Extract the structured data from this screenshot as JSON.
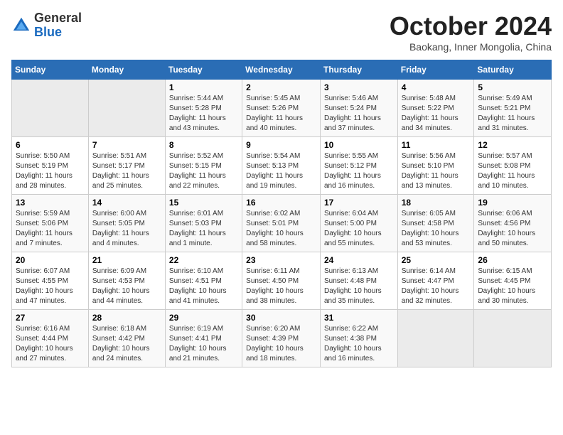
{
  "header": {
    "logo_line1": "General",
    "logo_line2": "Blue",
    "month": "October 2024",
    "location": "Baokang, Inner Mongolia, China"
  },
  "days_of_week": [
    "Sunday",
    "Monday",
    "Tuesday",
    "Wednesday",
    "Thursday",
    "Friday",
    "Saturday"
  ],
  "weeks": [
    [
      {
        "day": "",
        "detail": ""
      },
      {
        "day": "",
        "detail": ""
      },
      {
        "day": "1",
        "detail": "Sunrise: 5:44 AM\nSunset: 5:28 PM\nDaylight: 11 hours and 43 minutes."
      },
      {
        "day": "2",
        "detail": "Sunrise: 5:45 AM\nSunset: 5:26 PM\nDaylight: 11 hours and 40 minutes."
      },
      {
        "day": "3",
        "detail": "Sunrise: 5:46 AM\nSunset: 5:24 PM\nDaylight: 11 hours and 37 minutes."
      },
      {
        "day": "4",
        "detail": "Sunrise: 5:48 AM\nSunset: 5:22 PM\nDaylight: 11 hours and 34 minutes."
      },
      {
        "day": "5",
        "detail": "Sunrise: 5:49 AM\nSunset: 5:21 PM\nDaylight: 11 hours and 31 minutes."
      }
    ],
    [
      {
        "day": "6",
        "detail": "Sunrise: 5:50 AM\nSunset: 5:19 PM\nDaylight: 11 hours and 28 minutes."
      },
      {
        "day": "7",
        "detail": "Sunrise: 5:51 AM\nSunset: 5:17 PM\nDaylight: 11 hours and 25 minutes."
      },
      {
        "day": "8",
        "detail": "Sunrise: 5:52 AM\nSunset: 5:15 PM\nDaylight: 11 hours and 22 minutes."
      },
      {
        "day": "9",
        "detail": "Sunrise: 5:54 AM\nSunset: 5:13 PM\nDaylight: 11 hours and 19 minutes."
      },
      {
        "day": "10",
        "detail": "Sunrise: 5:55 AM\nSunset: 5:12 PM\nDaylight: 11 hours and 16 minutes."
      },
      {
        "day": "11",
        "detail": "Sunrise: 5:56 AM\nSunset: 5:10 PM\nDaylight: 11 hours and 13 minutes."
      },
      {
        "day": "12",
        "detail": "Sunrise: 5:57 AM\nSunset: 5:08 PM\nDaylight: 11 hours and 10 minutes."
      }
    ],
    [
      {
        "day": "13",
        "detail": "Sunrise: 5:59 AM\nSunset: 5:06 PM\nDaylight: 11 hours and 7 minutes."
      },
      {
        "day": "14",
        "detail": "Sunrise: 6:00 AM\nSunset: 5:05 PM\nDaylight: 11 hours and 4 minutes."
      },
      {
        "day": "15",
        "detail": "Sunrise: 6:01 AM\nSunset: 5:03 PM\nDaylight: 11 hours and 1 minute."
      },
      {
        "day": "16",
        "detail": "Sunrise: 6:02 AM\nSunset: 5:01 PM\nDaylight: 10 hours and 58 minutes."
      },
      {
        "day": "17",
        "detail": "Sunrise: 6:04 AM\nSunset: 5:00 PM\nDaylight: 10 hours and 55 minutes."
      },
      {
        "day": "18",
        "detail": "Sunrise: 6:05 AM\nSunset: 4:58 PM\nDaylight: 10 hours and 53 minutes."
      },
      {
        "day": "19",
        "detail": "Sunrise: 6:06 AM\nSunset: 4:56 PM\nDaylight: 10 hours and 50 minutes."
      }
    ],
    [
      {
        "day": "20",
        "detail": "Sunrise: 6:07 AM\nSunset: 4:55 PM\nDaylight: 10 hours and 47 minutes."
      },
      {
        "day": "21",
        "detail": "Sunrise: 6:09 AM\nSunset: 4:53 PM\nDaylight: 10 hours and 44 minutes."
      },
      {
        "day": "22",
        "detail": "Sunrise: 6:10 AM\nSunset: 4:51 PM\nDaylight: 10 hours and 41 minutes."
      },
      {
        "day": "23",
        "detail": "Sunrise: 6:11 AM\nSunset: 4:50 PM\nDaylight: 10 hours and 38 minutes."
      },
      {
        "day": "24",
        "detail": "Sunrise: 6:13 AM\nSunset: 4:48 PM\nDaylight: 10 hours and 35 minutes."
      },
      {
        "day": "25",
        "detail": "Sunrise: 6:14 AM\nSunset: 4:47 PM\nDaylight: 10 hours and 32 minutes."
      },
      {
        "day": "26",
        "detail": "Sunrise: 6:15 AM\nSunset: 4:45 PM\nDaylight: 10 hours and 30 minutes."
      }
    ],
    [
      {
        "day": "27",
        "detail": "Sunrise: 6:16 AM\nSunset: 4:44 PM\nDaylight: 10 hours and 27 minutes."
      },
      {
        "day": "28",
        "detail": "Sunrise: 6:18 AM\nSunset: 4:42 PM\nDaylight: 10 hours and 24 minutes."
      },
      {
        "day": "29",
        "detail": "Sunrise: 6:19 AM\nSunset: 4:41 PM\nDaylight: 10 hours and 21 minutes."
      },
      {
        "day": "30",
        "detail": "Sunrise: 6:20 AM\nSunset: 4:39 PM\nDaylight: 10 hours and 18 minutes."
      },
      {
        "day": "31",
        "detail": "Sunrise: 6:22 AM\nSunset: 4:38 PM\nDaylight: 10 hours and 16 minutes."
      },
      {
        "day": "",
        "detail": ""
      },
      {
        "day": "",
        "detail": ""
      }
    ]
  ]
}
